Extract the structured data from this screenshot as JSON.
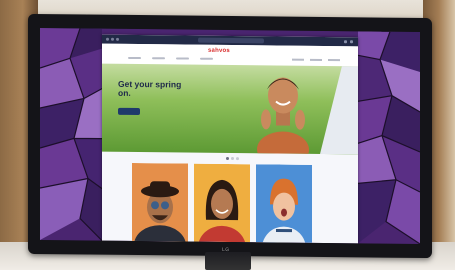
{
  "site": {
    "logo_text": "sahvos",
    "hero_headline": "Get your spring on."
  },
  "monitor": {
    "brand": "LG"
  },
  "colors": {
    "hero_grass": "#7fb24a",
    "card_1": "#e58f4a",
    "card_2": "#efae40",
    "card_3": "#4d8fd6",
    "wallpaper_purple": "#5b2f86",
    "browser_bar": "#222a47"
  },
  "photos": [
    {
      "subject": "man-with-hat-and-sunglasses"
    },
    {
      "subject": "smiling-woman"
    },
    {
      "subject": "surprised-child"
    }
  ]
}
